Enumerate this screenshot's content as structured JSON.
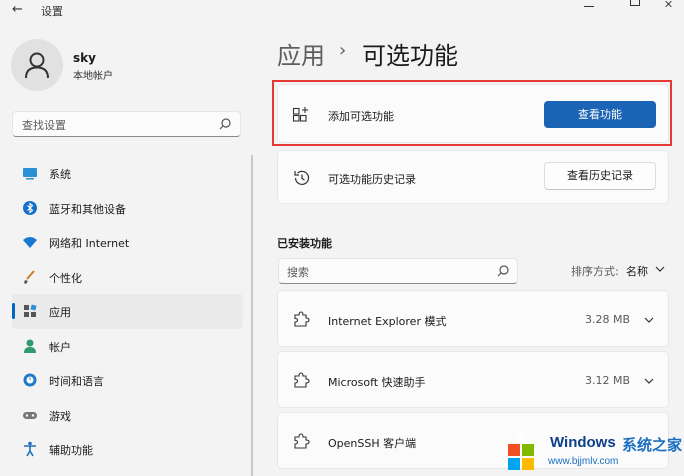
{
  "window": {
    "title": "设置"
  },
  "user": {
    "name": "sky",
    "account_type": "本地帐户"
  },
  "sidebar": {
    "search_placeholder": "查找设置",
    "items": [
      {
        "label": "系统",
        "icon": "system-icon"
      },
      {
        "label": "蓝牙和其他设备",
        "icon": "bluetooth-icon"
      },
      {
        "label": "网络和 Internet",
        "icon": "network-icon"
      },
      {
        "label": "个性化",
        "icon": "brush-icon"
      },
      {
        "label": "应用",
        "icon": "apps-icon",
        "active": true
      },
      {
        "label": "帐户",
        "icon": "account-icon"
      },
      {
        "label": "时间和语言",
        "icon": "time-language-icon"
      },
      {
        "label": "游戏",
        "icon": "gaming-icon"
      },
      {
        "label": "辅助功能",
        "icon": "accessibility-icon"
      }
    ]
  },
  "header": {
    "parent": "应用",
    "separator": "›",
    "current": "可选功能"
  },
  "add_feature": {
    "label": "添加可选功能",
    "button": "查看功能"
  },
  "history": {
    "label": "可选功能历史记录",
    "button": "查看历史记录"
  },
  "installed": {
    "title": "已安装功能",
    "search_placeholder": "搜索",
    "sort_label": "排序方式:",
    "sort_value": "名称",
    "features": [
      {
        "name": "Internet Explorer 模式",
        "size": "3.28 MB"
      },
      {
        "name": "Microsoft 快速助手",
        "size": "3.12 MB"
      },
      {
        "name": "OpenSSH 客户端",
        "size": ""
      }
    ]
  },
  "watermark": {
    "brand": "Windows",
    "cn": "系统之家",
    "url": "www.bjjmlv.com"
  },
  "colors": {
    "accent": "#1a63b5",
    "highlight_frame": "#e53935",
    "background": "#f3f3f3"
  }
}
